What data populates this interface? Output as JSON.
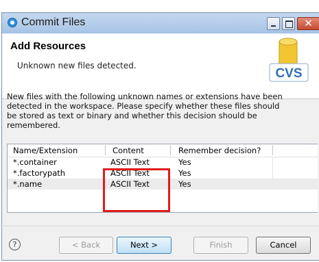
{
  "window": {
    "title": "Commit Files"
  },
  "header": {
    "title": "Add Resources",
    "message": "Unknown new files detected.",
    "logo_text": "CVS"
  },
  "description": {
    "lines": [
      "New files with the following unknown names or extensions have been",
      "detected in the workspace. Please specify whether these files should",
      "be stored as text or binary and whether this decision should be",
      "remembered."
    ]
  },
  "table": {
    "columns": [
      "Name/Extension",
      "Content",
      "Remember decision?"
    ],
    "rows": [
      {
        "name": "*.container",
        "content": "ASCII Text",
        "remember": "Yes"
      },
      {
        "name": "*.factorypath",
        "content": "ASCII Text",
        "remember": "Yes"
      },
      {
        "name": "*.name",
        "content": "ASCII Text",
        "remember": "Yes"
      }
    ]
  },
  "buttons": {
    "help": "?",
    "back": "< Back",
    "next": "Next >",
    "finish": "Finish",
    "cancel": "Cancel"
  },
  "colors": {
    "highlight": "#e11b1b",
    "titlebar": "#b6cfeb",
    "logo_blue": "#2f6fb7",
    "logo_yellow": "#f2c531"
  }
}
